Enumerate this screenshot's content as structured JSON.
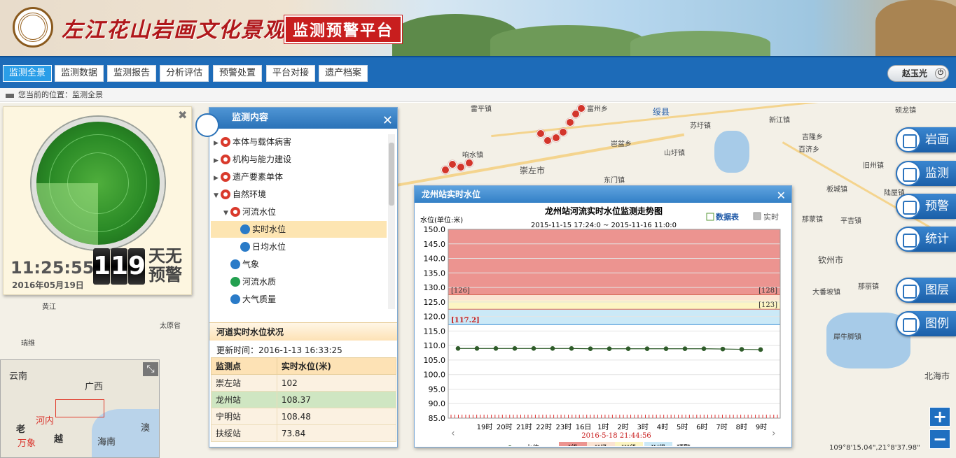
{
  "header": {
    "brand": "左江花山岩画文化景观",
    "platform": "监测预警平台"
  },
  "nav": {
    "items": [
      "监测全景",
      "监测数据",
      "监测报告",
      "分析评估",
      "预警处置",
      "平台对接",
      "遗产档案"
    ],
    "user": "赵玉光"
  },
  "breadcrumb": "您当前的位置：监测全景",
  "radar_card": {
    "time": "11:25:55",
    "date": "2016年05月19日",
    "days_digits": [
      "1",
      "1",
      "9"
    ],
    "days_text": "天无预警"
  },
  "monitor_panel": {
    "title": "监测内容",
    "tree": [
      {
        "label": "本体与载体病害",
        "icon": "eye-icon",
        "arrow": "▶"
      },
      {
        "label": "机构与能力建设",
        "icon": "eye-icon",
        "arrow": "▶"
      },
      {
        "label": "遗产要素单体",
        "icon": "eye-icon",
        "arrow": "▶"
      },
      {
        "label": "自然环境",
        "icon": "eye-icon",
        "arrow": "▼"
      },
      {
        "label": "河流水位",
        "icon": "eye-icon",
        "arrow": "▼"
      },
      {
        "label": "实时水位",
        "icon": "water-level-icon"
      },
      {
        "label": "日均水位",
        "icon": "water-level-icon"
      },
      {
        "label": "气象",
        "icon": "weather-icon"
      },
      {
        "label": "河流水质",
        "icon": "water-quality-icon"
      },
      {
        "label": "大气质量",
        "icon": "air-quality-icon"
      }
    ],
    "status_title": "河道实时水位状况",
    "update_time": "更新时间：2016-1-13 16:33:25",
    "table": {
      "headers": [
        "监测点",
        "实时水位(米)"
      ],
      "rows": [
        [
          "崇左站",
          "102"
        ],
        [
          "龙州站",
          "108.37"
        ],
        [
          "宁明站",
          "108.48"
        ],
        [
          "扶绥站",
          "73.84"
        ]
      ]
    }
  },
  "chart_window": {
    "title": "龙州站实时水位",
    "data_table_label": "数据表",
    "realtime_label": "实时",
    "footer_date": "2016-5-18 21:44:56"
  },
  "chart_data": {
    "type": "line",
    "title": "龙州站河流实时水位监测走势图",
    "subtitle": "2015-11-15 17:24:0 ~ 2015-11-16 11:0:0",
    "ylabel": "水位(单位:米)",
    "ylim": [
      85,
      150
    ],
    "yticks": [
      85.0,
      90.0,
      95.0,
      100.0,
      105.0,
      110.0,
      115.0,
      120.0,
      125.0,
      130.0,
      135.0,
      140.0,
      145.0,
      150.0
    ],
    "x_tick_labels": [
      "19时",
      "20时",
      "21时",
      "22时",
      "23时",
      "16日",
      "1时",
      "2时",
      "3时",
      "4时",
      "5时",
      "6时",
      "7时",
      "8时",
      "9时"
    ],
    "series": [
      {
        "name": "水位",
        "values": [
          109.0,
          109.0,
          109.0,
          109.0,
          109.0,
          109.0,
          109.0,
          108.9,
          108.9,
          108.9,
          108.9,
          108.9,
          108.9,
          108.9,
          108.8,
          108.7,
          108.6
        ]
      }
    ],
    "bands": [
      {
        "name": "I级",
        "from": 127.5,
        "to": 150,
        "color": "#ec9490"
      },
      {
        "name": "II级",
        "from": 125.5,
        "to": 127.5,
        "color": "#fbe3d2"
      },
      {
        "name": "III级",
        "from": 122.5,
        "to": 125.5,
        "color": "#fcf5c3"
      },
      {
        "name": "IV级",
        "from": 117.2,
        "to": 122.5,
        "color": "#cbe9f7"
      }
    ],
    "threshold_labels": [
      {
        "text": "[126]",
        "value": 127.5,
        "side": "left"
      },
      {
        "text": "[128]",
        "value": 127.5,
        "side": "right"
      },
      {
        "text": "[123]",
        "value": 122.5,
        "side": "right"
      },
      {
        "text": "[117.2]",
        "value": 117.2,
        "side": "left"
      }
    ],
    "legend": [
      "水位",
      "I级",
      "II级",
      "III级",
      "IV级",
      "预警"
    ]
  },
  "tools": [
    "岩画",
    "监测",
    "预警",
    "统计",
    "图层",
    "图例"
  ],
  "map_labels": [
    "雷平镇",
    "富州乡",
    "硕龙镇",
    "绥县",
    "苏圩镇",
    "新江镇",
    "响水镇",
    "崇左市",
    "岜盆乡",
    "山圩镇",
    "东门镇",
    "吉隆乡",
    "百济乡",
    "旧州镇",
    "陆屋镇",
    "板城镇",
    "那蒙镇",
    "平吉镇",
    "钦州市",
    "大番坡镇",
    "那丽镇",
    "犀牛脚镇",
    "北海市",
    "太原省",
    "黄江",
    "瑞维"
  ],
  "minimap_labels": [
    "云南",
    "广西",
    "河内",
    "老",
    "越",
    "万象",
    "海南",
    "澳"
  ],
  "zoom": {
    "in": "+",
    "out": "−"
  },
  "coord": "109°8'15.04\",21°8'37.98\""
}
